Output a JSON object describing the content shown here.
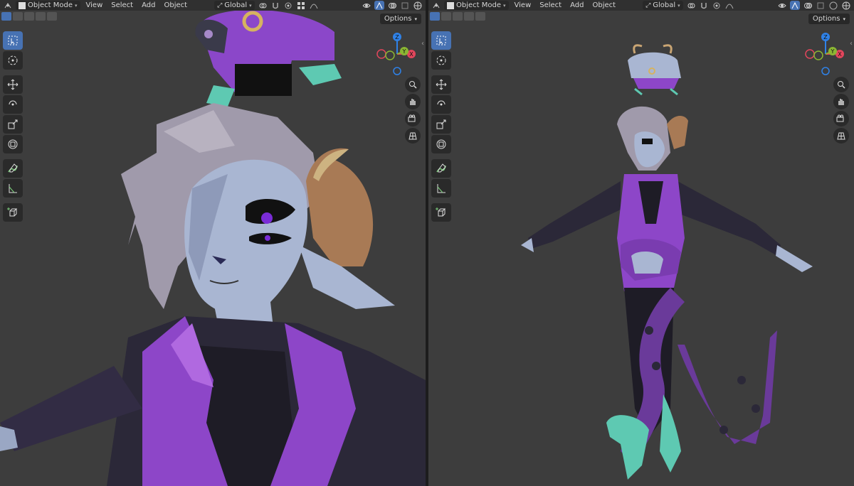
{
  "left_viewport": {
    "header": {
      "mode_label": "Object Mode",
      "menus": [
        "View",
        "Select",
        "Add",
        "Object"
      ],
      "transform_orientation": "Global"
    },
    "options_label": "Options",
    "gizmo": {
      "x": "X",
      "y": "Y",
      "z": "Z"
    }
  },
  "right_viewport": {
    "header": {
      "mode_label": "Object Mode",
      "menus": [
        "View",
        "Select",
        "Add",
        "Object"
      ],
      "transform_orientation": "Global"
    },
    "options_label": "Options",
    "gizmo": {
      "x": "X",
      "y": "Y",
      "z": "Z"
    }
  },
  "colors": {
    "viewport_bg": "#3d3d3d",
    "header_bg": "#303030",
    "accent": "#4772b3",
    "axis_x": "#e2465c",
    "axis_y": "#8bb633",
    "axis_z": "#2f82e8"
  },
  "icons": [
    "editor-type-icon",
    "object-mode-icon",
    "transform-pivot-icon",
    "snap-icon",
    "proportional-edit-icon",
    "overlay-icon",
    "xray-icon",
    "shading-solid-icon",
    "select-box-icon",
    "cursor-icon",
    "move-icon",
    "rotate-icon",
    "scale-icon",
    "transform-icon",
    "annotate-icon",
    "measure-icon",
    "add-cube-icon",
    "zoom-icon",
    "pan-hand-icon",
    "camera-icon",
    "grid-icon"
  ]
}
